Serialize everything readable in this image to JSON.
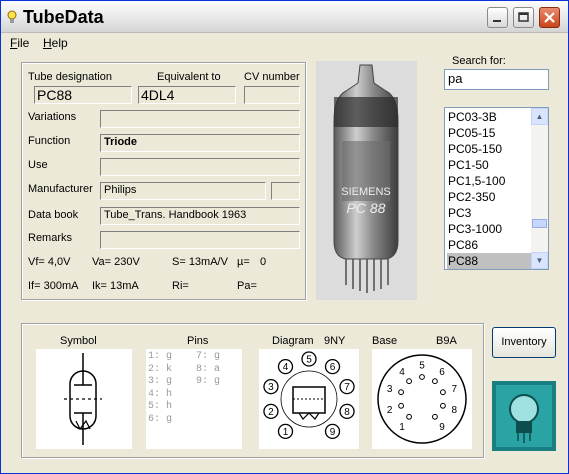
{
  "window": {
    "title": "TubeData"
  },
  "menu": {
    "file": "File",
    "file_key": "F",
    "file_rest": "ile",
    "help": "Help",
    "help_key": "H",
    "help_rest": "elp"
  },
  "labels": {
    "tube_designation": "Tube designation",
    "equivalent_to": "Equivalent to",
    "cv_number": "CV number",
    "variations": "Variations",
    "function": "Function",
    "use": "Use",
    "manufacturer": "Manufacturer",
    "data_book": "Data book",
    "remarks": "Remarks"
  },
  "fields": {
    "tube_designation": "PC88",
    "equivalent_to": "4DL4",
    "cv_number": "",
    "variations": "",
    "function": "Triode",
    "use": "",
    "manufacturer": "Philips",
    "manufacturer_extra": "",
    "data_book": "Tube_Trans. Handbook 1963",
    "remarks": ""
  },
  "specs": {
    "vf": "Vf= 4,0V",
    "va": "Va= 230V",
    "s": "S= 13mA/V",
    "mu": "µ=",
    "mu_val": "0",
    "if": "If= 300mA",
    "ik": "Ik=  13mA",
    "ri": "Ri=",
    "pa": "Pa="
  },
  "search": {
    "label": "Search for:",
    "value": "pa"
  },
  "tube_list": [
    "PC03-3B",
    "PC05-15",
    "PC05-150",
    "PC1-50",
    "PC1,5-100",
    "PC2-350",
    "PC3",
    "PC3-1000",
    "PC86",
    "PC88"
  ],
  "tube_list_selected": "PC88",
  "bottom": {
    "symbol_label": "Symbol",
    "pins_label": "Pins",
    "diagram_label": "Diagram",
    "diagram_code": "9NY",
    "base_label": "Base",
    "base_code": "B9A",
    "pins_col1": [
      "1: g",
      "2: k",
      "3: g",
      "4: h",
      "5: h",
      "6: g"
    ],
    "pins_col2": [
      "7: g",
      "8: a",
      "9: g"
    ],
    "diagram_numbers": [
      "1",
      "2",
      "3",
      "4",
      "5",
      "6",
      "7",
      "8",
      "9"
    ],
    "base_numbers": [
      "1",
      "2",
      "3",
      "4",
      "5",
      "6",
      "7",
      "8",
      "9"
    ]
  },
  "buttons": {
    "inventory": "Inventory"
  },
  "photo": {
    "brand_text": "SIEMENS",
    "tube_text": "PC 88"
  },
  "colors": {
    "title_bar": "#e6e6e6",
    "close_button": "#d0502a",
    "selection": "#c0c0c0",
    "window_bg": "#ece9d8"
  }
}
